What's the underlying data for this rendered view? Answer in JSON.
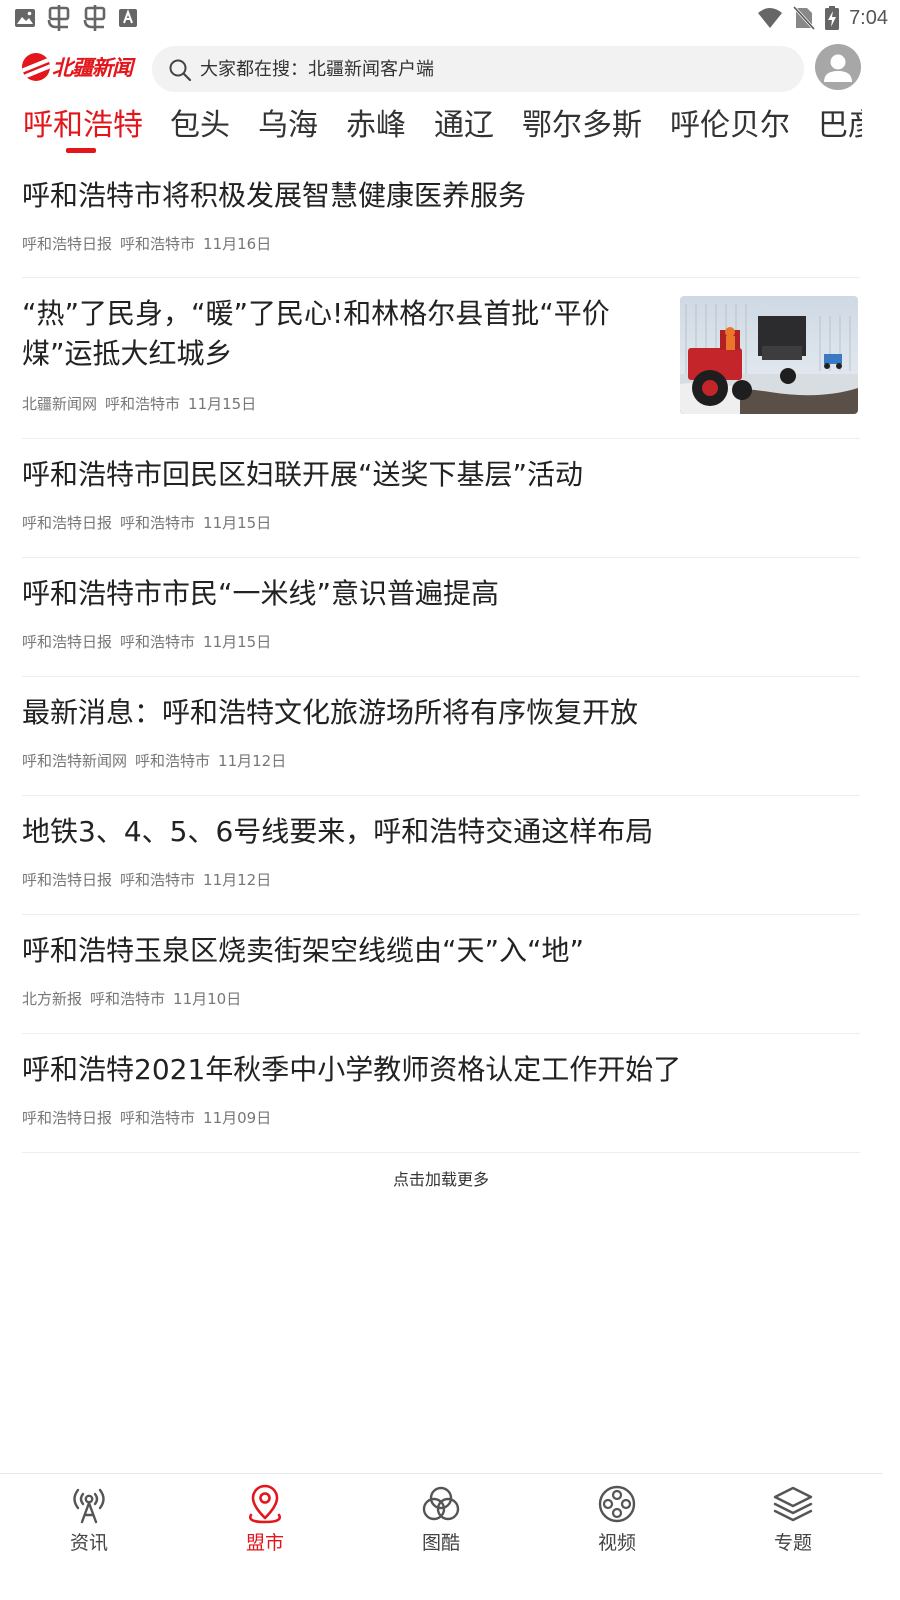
{
  "status_bar": {
    "time": "7:04",
    "left_icons": [
      "image-icon",
      "bug-icon",
      "bug-icon",
      "a-badge-icon"
    ],
    "right_icons": [
      "wifi-icon",
      "no-sim-icon",
      "battery-charging-icon"
    ]
  },
  "header": {
    "logo_text": "北疆新闻",
    "search_placeholder": "大家都在搜：北疆新闻客户端",
    "avatar_icon": "user-avatar-icon"
  },
  "tabs": [
    {
      "label": "呼和浩特",
      "active": true
    },
    {
      "label": "包头",
      "active": false
    },
    {
      "label": "乌海",
      "active": false
    },
    {
      "label": "赤峰",
      "active": false
    },
    {
      "label": "通辽",
      "active": false
    },
    {
      "label": "鄂尔多斯",
      "active": false
    },
    {
      "label": "呼伦贝尔",
      "active": false
    },
    {
      "label": "巴彦",
      "active": false
    }
  ],
  "news": [
    {
      "title": "呼和浩特市将积极发展智慧健康医养服务",
      "source": "呼和浩特日报",
      "region": "呼和浩特市",
      "date": "11月16日"
    },
    {
      "title": "“热”了民身，“暖”了民心!和林格尔县首批“平价煤”运抵大红城乡",
      "source": "北疆新闻网",
      "region": "呼和浩特市",
      "date": "11月15日",
      "has_image": true
    },
    {
      "title": "呼和浩特市回民区妇联开展“送奖下基层”活动",
      "source": "呼和浩特日报",
      "region": "呼和浩特市",
      "date": "11月15日"
    },
    {
      "title": "呼和浩特市市民“一米线”意识普遍提高",
      "source": "呼和浩特日报",
      "region": "呼和浩特市",
      "date": "11月15日"
    },
    {
      "title": "最新消息：呼和浩特文化旅游场所将有序恢复开放",
      "source": "呼和浩特新闻网",
      "region": "呼和浩特市",
      "date": "11月12日"
    },
    {
      "title": "地铁3、4、5、6号线要来，呼和浩特交通这样布局",
      "source": "呼和浩特日报",
      "region": "呼和浩特市",
      "date": "11月12日"
    },
    {
      "title": "呼和浩特玉泉区烧卖街架空线缆由“天”入“地”",
      "source": "北方新报",
      "region": "呼和浩特市",
      "date": "11月10日"
    },
    {
      "title": "呼和浩特2021年秋季中小学教师资格认定工作开始了",
      "source": "呼和浩特日报",
      "region": "呼和浩特市",
      "date": "11月09日"
    }
  ],
  "load_more": "点击加载更多",
  "bottom_nav": [
    {
      "label": "资讯",
      "icon": "broadcast-icon",
      "active": false
    },
    {
      "label": "盟市",
      "icon": "location-pin-icon",
      "active": true
    },
    {
      "label": "图酷",
      "icon": "overlapping-circles-icon",
      "active": false
    },
    {
      "label": "视频",
      "icon": "film-reel-icon",
      "active": false
    },
    {
      "label": "专题",
      "icon": "layers-icon",
      "active": false
    }
  ],
  "colors": {
    "accent": "#e3161c",
    "text": "#222222",
    "meta": "#777777",
    "divider": "#eeeeee"
  }
}
